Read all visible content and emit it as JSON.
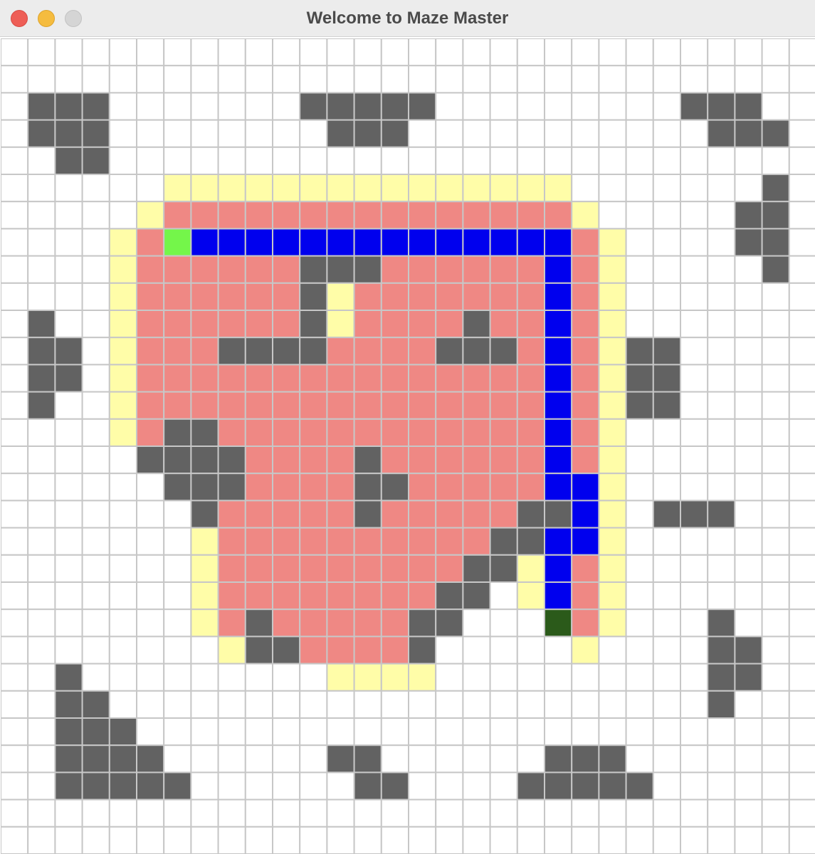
{
  "window": {
    "title": "Welcome to Maze Master"
  },
  "colors": {
    "empty": "#ffffff",
    "wall": "#626262",
    "visited": "#ef8884",
    "frontier": "#fffda8",
    "path": "#0000ee",
    "start": "#74f64a",
    "goal": "#2b5a1a",
    "grid_line": "#c7c7c7"
  },
  "grid": {
    "rows": 30,
    "cols": 30,
    "legend": {
      ".": "empty",
      "#": "wall",
      "r": "visited",
      "y": "frontier",
      "b": "path",
      "S": "start",
      "G": "goal"
    },
    "cells": [
      "..............................",
      "..............................",
      ".###.......#####.........###..",
      ".###........###...........###.",
      "..##..........................",
      "......yyyyyyyyyyyyyyy.......#.",
      ".....yrrrrrrrrrrrrrrry.....##.",
      "....yrSbbbbbbbbbbbbbbry....##.",
      "....yrrrrrr###rrrrrrbry.....#.",
      "....yrrrrrr#yrrrrrrrbry.......",
      ".#..yrrrrrr#yrrrr#rrbry.......",
      ".##.yrrr####rrrr###rbry##.....",
      ".##.yrrrrrrrrrrrrrrrbry##.....",
      ".#..yrrrrrrrrrrrrrrrbry##.....",
      "....yr##rrrrrrrrrrrrbry.......",
      ".....####rrrr#rrrrrrbry.......",
      "......###rrrr##rrrrrbby.......",
      ".......#rrrrr#rrrrr##by.###...",
      ".......yrrrrrrrrrr##bby.......",
      ".......yrrrrrrrrr##ybry.......",
      ".......yrrrrrrrr##.ybry.......",
      ".......yr#rrrrr##...Gry...#...",
      "........y##rrrr#.....y....##..",
      "..#.........yyyy..........##..",
      "..##......................#...",
      "..###.........................",
      "..####......##......###.......",
      "..#####......##....#####......",
      "..............................",
      ".............................."
    ]
  }
}
